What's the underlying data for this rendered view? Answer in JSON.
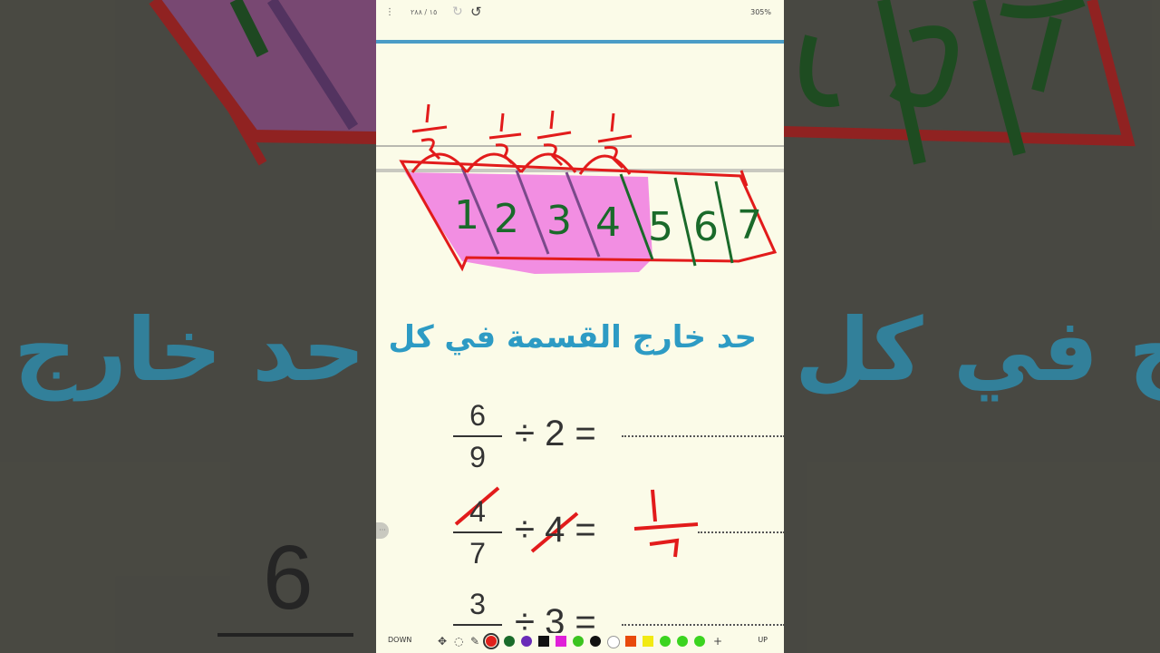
{
  "topbar": {
    "page_indicator": "١٥ / ٢٨٨",
    "zoom": "305%"
  },
  "heading": "حد خارج القسمة في كل",
  "handwriting": {
    "boxes": [
      "1",
      "2",
      "3",
      "4",
      "5",
      "6",
      "7"
    ],
    "unit_fraction_marks": "1/7",
    "answer_numerator": "1",
    "answer_denominator": "7"
  },
  "equations": [
    {
      "numerator": "6",
      "denominator": "9",
      "rest": "÷ 2 ="
    },
    {
      "numerator": "4",
      "denominator": "7",
      "rest": "÷ 4 ="
    },
    {
      "numerator": "3",
      "denominator": "",
      "rest": "÷ 3 ="
    }
  ],
  "toolbar": {
    "down_label": "DOWN",
    "up_label": "UP",
    "plus_label": "+",
    "colors": [
      "#e0201b",
      "#1a6b2a",
      "#6a2bb8",
      "#111111",
      "#e020d8",
      "#3bc41f",
      "#111111",
      "#ffffff",
      "#e84a0c",
      "#f2ea12",
      "#3bd41f",
      "#3bd41f",
      "#3bd41f"
    ],
    "selected_color": "#e0201b"
  },
  "side_background": {
    "title": "حد خارج في كل",
    "digit": "6"
  },
  "icons": {
    "menu": "more-vertical-icon",
    "redo": "redo-icon",
    "undo": "undo-icon",
    "move": "move-icon",
    "lasso": "lasso-icon",
    "pen": "pen-icon"
  }
}
